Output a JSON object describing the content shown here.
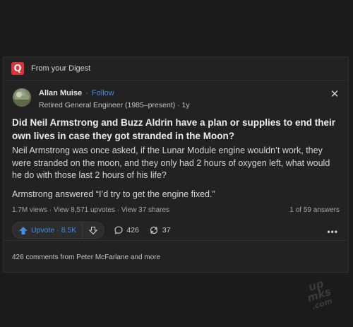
{
  "digest": {
    "label": "From your Digest",
    "logo_letter": "Q"
  },
  "author": {
    "name": "Allan Muise",
    "follow_label": "Follow",
    "credential": "Retired General Engineer (1985–present) · 1y"
  },
  "post": {
    "question": "Did Neil Armstrong and Buzz Aldrin have a plan or supplies to end their own lives in case they got stranded in the Moon?",
    "paragraph1": "Neil Armstrong was once asked, if the Lunar Module engine wouldn’t work, they were stranded on the moon, and they only had 2 hours of oxygen left, what would he do with those last 2 hours of his life?",
    "paragraph2": "Armstrong answered “I’d try to get the engine fixed.”",
    "stats": "1.7M views · View 8,571 upvotes · View 37 shares",
    "answers_count": "1 of 59 answers"
  },
  "actions": {
    "upvote_label": "Upvote",
    "upvote_count": "8.5K",
    "comments_count": "426",
    "shares_count": "37",
    "more_label": "•••"
  },
  "comments_summary": "426 comments from Peter McFarlane and more",
  "watermark": {
    "line1": "up",
    "line2": "mks",
    "line3": ".com"
  },
  "colors": {
    "background": "#1b1b1b",
    "card": "#222222",
    "accent_blue": "#3f8fe6",
    "brand_red": "#e0313b"
  }
}
